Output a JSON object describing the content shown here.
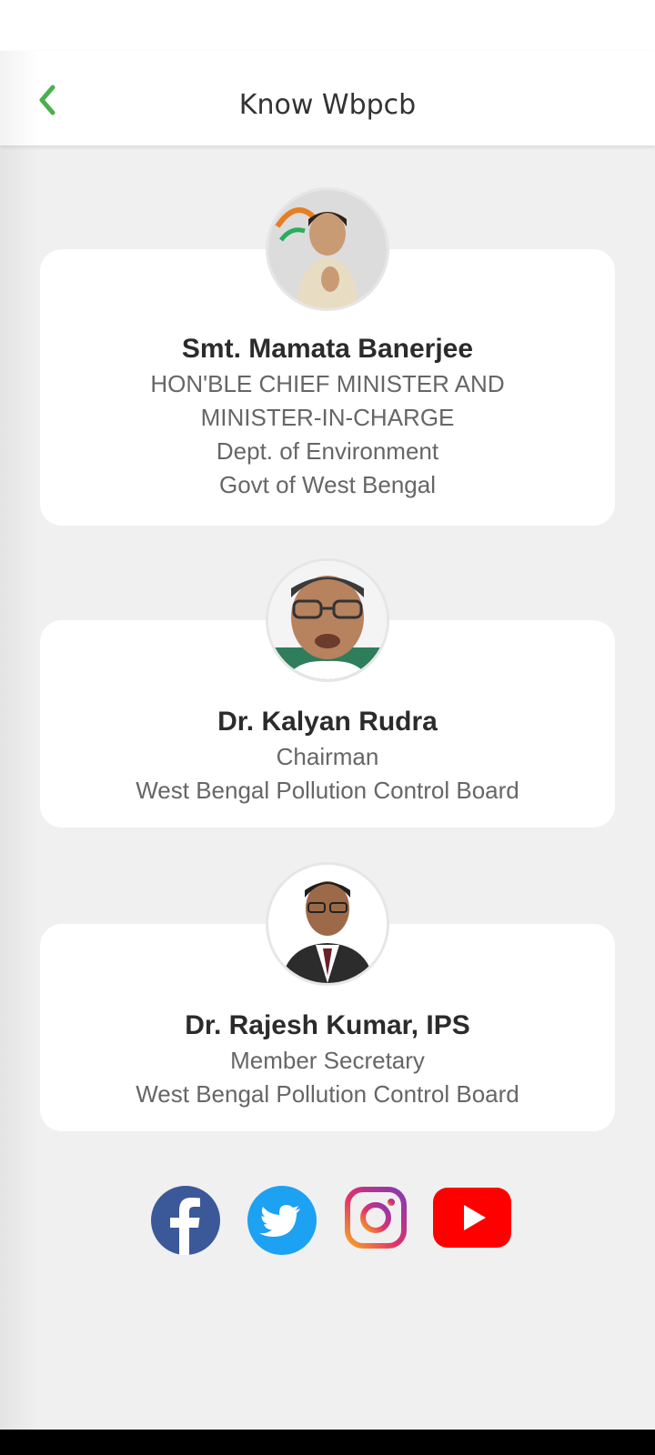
{
  "header": {
    "title": "Know Wbpcb",
    "back_icon": "chevron-left-icon",
    "accent_color": "#4caf50"
  },
  "people": [
    {
      "name": "Smt. Mamata Banerjee",
      "lines": [
        "HON'BLE CHIEF MINISTER AND",
        "MINISTER-IN-CHARGE",
        "Dept. of Environment",
        "Govt of West Bengal"
      ]
    },
    {
      "name": "Dr. Kalyan Rudra",
      "lines": [
        "Chairman",
        "West Bengal Pollution Control Board"
      ]
    },
    {
      "name": "Dr. Rajesh Kumar, IPS",
      "lines": [
        "Member Secretary",
        "West Bengal Pollution Control Board"
      ]
    }
  ],
  "social": [
    {
      "icon": "facebook-icon",
      "color": "#3b5998"
    },
    {
      "icon": "twitter-icon",
      "color": "#1da1f2"
    },
    {
      "icon": "instagram-icon",
      "color": "#c13584"
    },
    {
      "icon": "youtube-icon",
      "color": "#ff0000"
    }
  ]
}
